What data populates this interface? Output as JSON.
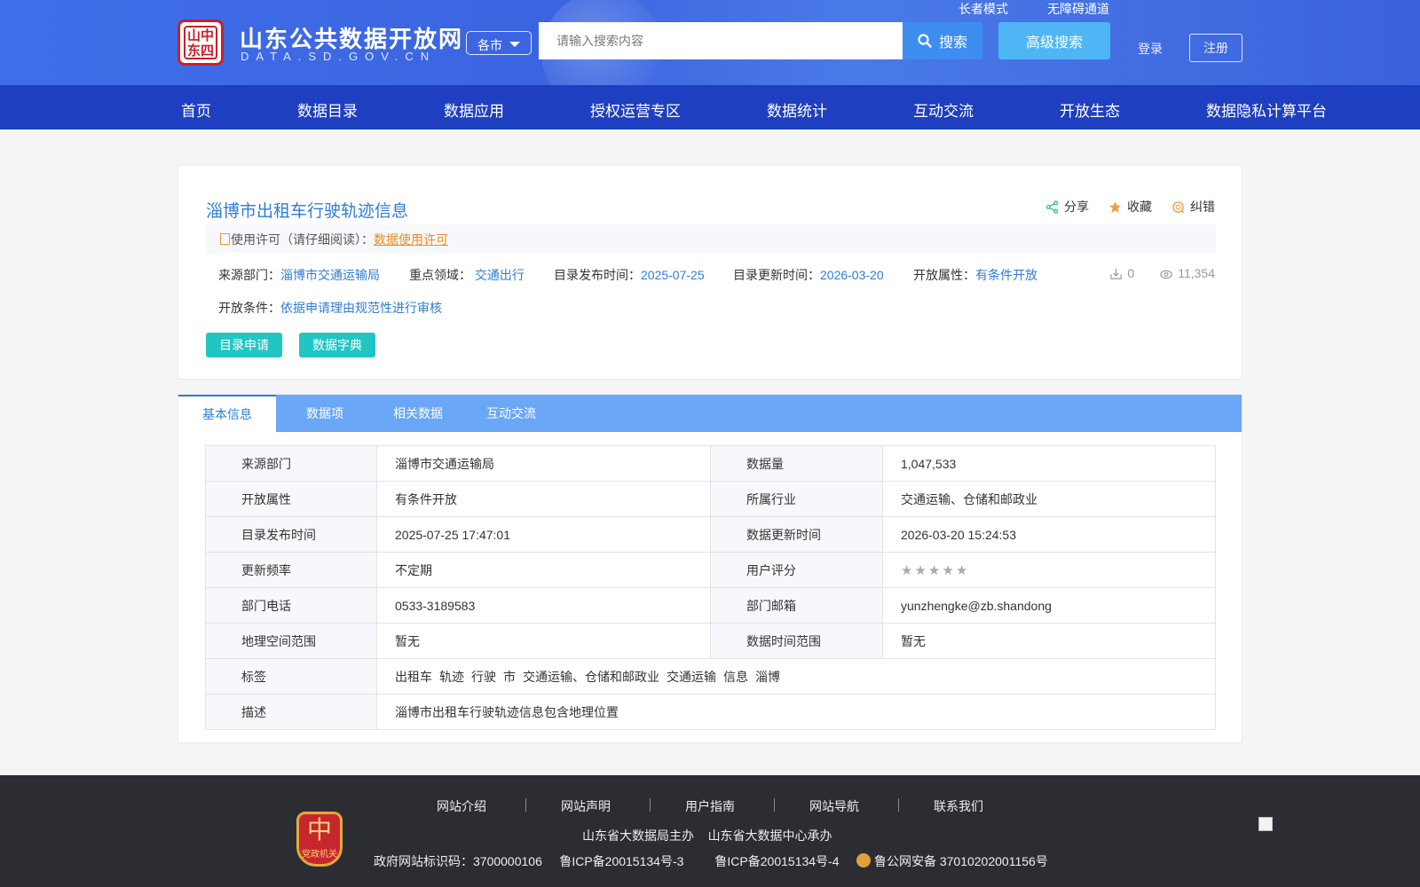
{
  "header": {
    "site_title": "山东公共数据开放网",
    "site_subtitle": "DATA.SD.GOV.CN",
    "logo_text": "山东四中",
    "city_select": "各市",
    "search_placeholder": "请输入搜索内容",
    "search_button": "搜索",
    "advanced_search": "高级搜索",
    "elder_mode": "长者模式",
    "accessibility": "无障碍通道",
    "login": "登录",
    "register": "注册"
  },
  "nav": {
    "items": [
      "首页",
      "数据目录",
      "数据应用",
      "授权运营专区",
      "数据统计",
      "互动交流",
      "开放生态",
      "数据隐私计算平台"
    ]
  },
  "dataset": {
    "title": "淄博市出租车行驶轨迹信息",
    "actions": {
      "share": "分享",
      "favorite": "收藏",
      "correct": "纠错"
    },
    "license_label": "使用许可（请仔细阅读）：",
    "license_link": "数据使用许可",
    "meta": {
      "source_label": "来源部门：",
      "source": "淄博市交通运输局",
      "field_label": "重点领域：",
      "field": "交通出行",
      "publish_label": "目录发布时间：",
      "publish": "2025-07-25",
      "update_label": "目录更新时间：",
      "update": "2026-03-20",
      "open_label": "开放属性：",
      "open": "有条件开放"
    },
    "downloads": "0",
    "views": "11,354",
    "condition_label": "开放条件：",
    "condition": "依据申请理由规范性进行审核",
    "buttons": {
      "apply": "目录申请",
      "dictionary": "数据字典"
    }
  },
  "tabs": [
    "基本信息",
    "数据项",
    "相关数据",
    "互动交流"
  ],
  "info": {
    "rows": [
      {
        "k1": "来源部门",
        "v1": "淄博市交通运输局",
        "k2": "数据量",
        "v2": "1,047,533"
      },
      {
        "k1": "开放属性",
        "v1": "有条件开放",
        "k2": "所属行业",
        "v2": "交通运输、仓储和邮政业"
      },
      {
        "k1": "目录发布时间",
        "v1": "2025-07-25 17:47:01",
        "k2": "数据更新时间",
        "v2": "2026-03-20 15:24:53"
      },
      {
        "k1": "更新频率",
        "v1": "不定期",
        "k2": "用户评分",
        "v2": ""
      },
      {
        "k1": "部门电话",
        "v1": "0533-3189583",
        "k2": "部门邮箱",
        "v2": "yunzhengke@zb.shandong"
      },
      {
        "k1": "地理空间范围",
        "v1": "暂无",
        "k2": "数据时间范围",
        "v2": "暂无"
      }
    ],
    "rating": 0,
    "tags_label": "标签",
    "tags": [
      "出租车",
      "轨迹",
      "行驶",
      "市",
      "交通运输、仓储和邮政业",
      "交通运输",
      "信息",
      "淄博"
    ],
    "desc_label": "描述",
    "desc": "淄博市出租车行驶轨迹信息包含地理位置"
  },
  "footer": {
    "links": [
      "网站介绍",
      "网站声明",
      "用户指南",
      "网站导航",
      "联系我们"
    ],
    "host": "山东省大数据局主办",
    "organizer": "山东省大数据中心承办",
    "gov_id": "政府网站标识码：3700000106",
    "icp1": "鲁ICP备20015134号-3",
    "icp2": "鲁ICP备20015134号-4",
    "police": "鲁公网安备 37010202001156号",
    "badge_char": "中",
    "badge_text": "党政机关"
  },
  "colors": {
    "brand_blue": "#3b64e0",
    "nav_blue": "#1e3fbf",
    "link_blue": "#2f7cd6",
    "teal": "#21c6c3",
    "orange": "#f08a1c"
  }
}
